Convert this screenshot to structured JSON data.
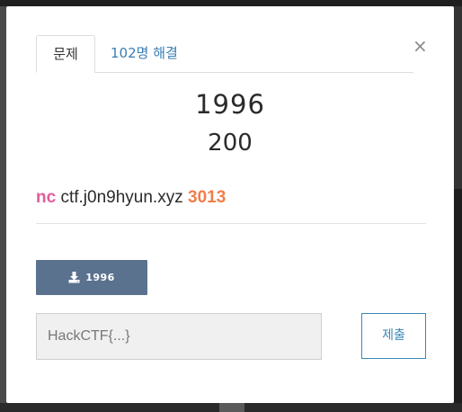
{
  "modal": {
    "close_glyph": "×",
    "tabs": [
      {
        "label": "문제",
        "active": true
      },
      {
        "label": "102명 해결",
        "active": false
      }
    ],
    "challenge": {
      "name": "1996",
      "value": "200",
      "description": {
        "command": "nc",
        "host": "ctf.j0n9hyun.xyz",
        "port": "3013"
      },
      "file": {
        "icon": "download-icon",
        "label": "1996"
      }
    },
    "flag_input": {
      "value": "",
      "placeholder": "HackCTF{...}"
    },
    "submit_label": "제출"
  },
  "colors": {
    "command": "#e45b9a",
    "port": "#f07d4a",
    "file_button_bg": "#5b728f",
    "submit_accent": "#3a88b8",
    "tab_link": "#3a7eb5"
  }
}
